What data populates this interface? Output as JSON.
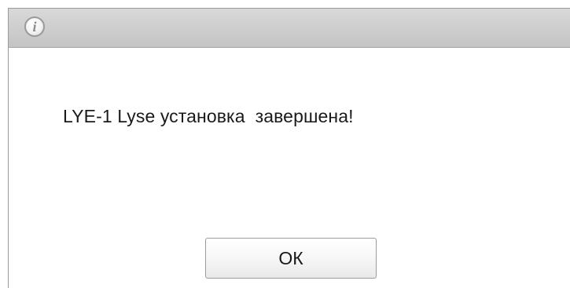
{
  "dialog": {
    "icon": "info-icon",
    "icon_glyph": "i",
    "message": "LYE-1 Lyse установка  завершена!",
    "ok_label": "ОК"
  },
  "colors": {
    "titlebar": "#cfcfcf",
    "border": "#9a9a9a",
    "text": "#1a1a1a"
  }
}
